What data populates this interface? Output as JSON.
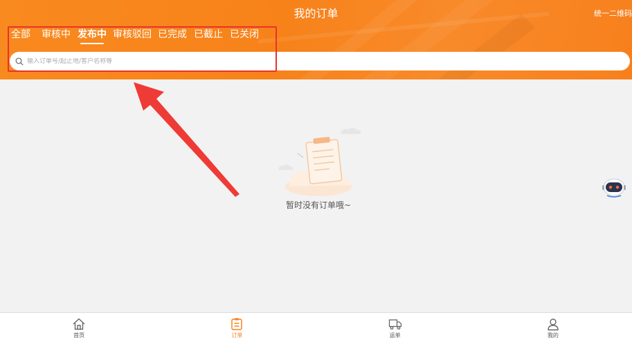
{
  "header": {
    "title": "我的订单",
    "qr_link": "统一二维码"
  },
  "tabs": [
    {
      "label": "全部",
      "active": false
    },
    {
      "label": "审核中",
      "active": false
    },
    {
      "label": "发布中",
      "active": true
    },
    {
      "label": "审核驳回",
      "active": false
    },
    {
      "label": "已完成",
      "active": false
    },
    {
      "label": "已截止",
      "active": false
    },
    {
      "label": "已关闭",
      "active": false
    }
  ],
  "search": {
    "placeholder": "输入订单号/起止地/客户名称等",
    "value": ""
  },
  "empty_state": {
    "message": "暂时没有订单哦~"
  },
  "bottom_nav": [
    {
      "label": "首页",
      "icon": "home-icon",
      "active": false
    },
    {
      "label": "订单",
      "icon": "order-icon",
      "active": true
    },
    {
      "label": "运单",
      "icon": "truck-icon",
      "active": false
    },
    {
      "label": "我的",
      "icon": "user-icon",
      "active": false
    }
  ],
  "colors": {
    "brand": "#f7821a",
    "highlight": "#e8322c"
  }
}
